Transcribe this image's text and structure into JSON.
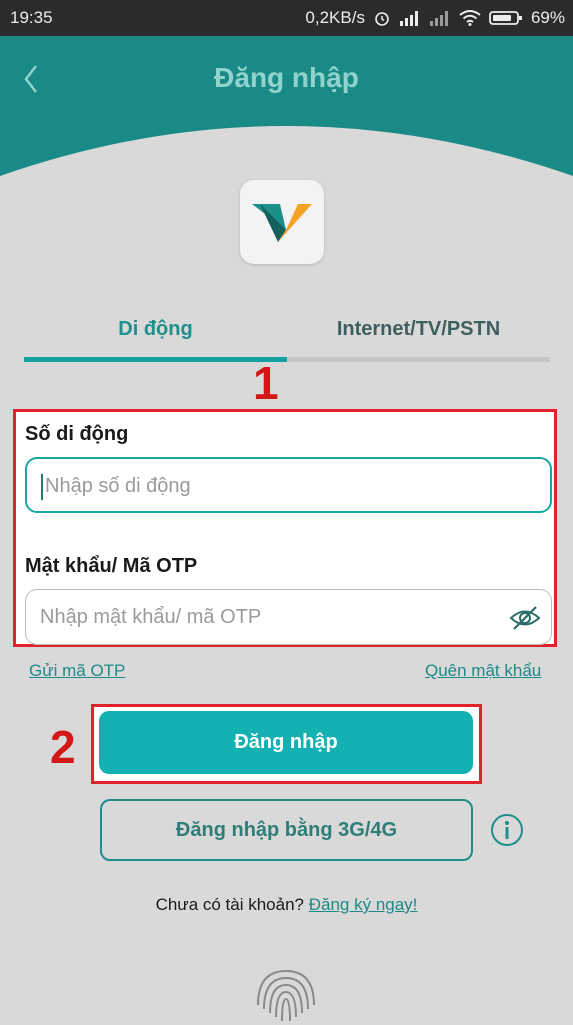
{
  "statusbar": {
    "time": "19:35",
    "speed": "0,2KB/s",
    "battery": "69%"
  },
  "header": {
    "title": "Đăng nhập"
  },
  "tabs": [
    {
      "label": "Di động"
    },
    {
      "label": "Internet/TV/PSTN"
    }
  ],
  "markers": {
    "one": "1",
    "two": "2"
  },
  "form": {
    "phone_label": "Số di động",
    "phone_placeholder": "Nhập số di động",
    "password_label": "Mật khẩu/ Mã OTP",
    "password_placeholder": "Nhập mật khẩu/ mã OTP"
  },
  "links": {
    "send_otp": "Gửi mã OTP",
    "forgot": "Quên mật khẩu"
  },
  "buttons": {
    "login": "Đăng nhập",
    "login_3g": "Đăng nhập bằng 3G/4G"
  },
  "signup": {
    "question": "Chưa có tài khoản?",
    "link": "Đăng ký ngay!"
  },
  "colors": {
    "accent": "#13b1b1",
    "header": "#1a8a86",
    "highlight": "#e0232b"
  }
}
